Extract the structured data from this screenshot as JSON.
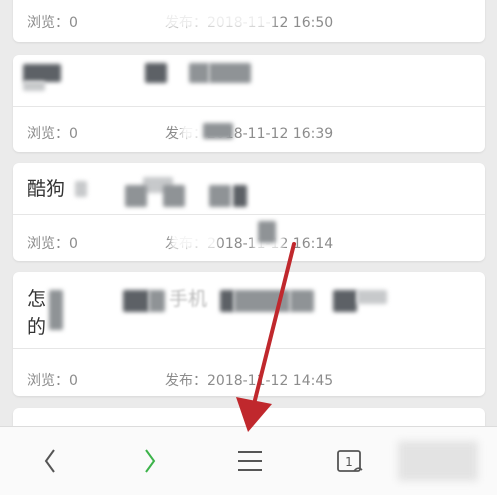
{
  "articles": [
    {
      "title": "",
      "views_label": "浏览：0",
      "date_label": "发布：2018-11-12 16:50"
    },
    {
      "title": "",
      "views_label": "浏览：0",
      "date_label": "发布：2018-11-12 16:39"
    },
    {
      "title": "酷狗",
      "views_label": "浏览：0",
      "date_label": "发布：2018-11-12 16:14"
    },
    {
      "title_line1": "怎",
      "title_line1_mid": "手机",
      "title_line2": "的",
      "views_label": "浏览：0",
      "date_label": "发布：2018-11-12 14:45"
    }
  ],
  "toolbar": {
    "back_icon": "chevron-left-icon",
    "forward_icon": "chevron-right-icon",
    "menu_icon": "hamburger-menu-icon",
    "tabs_icon": "tabs-icon",
    "tabs_count": "1",
    "forward_color": "#3cb34a"
  },
  "annotation": {
    "arrow_color": "#c0282d"
  }
}
